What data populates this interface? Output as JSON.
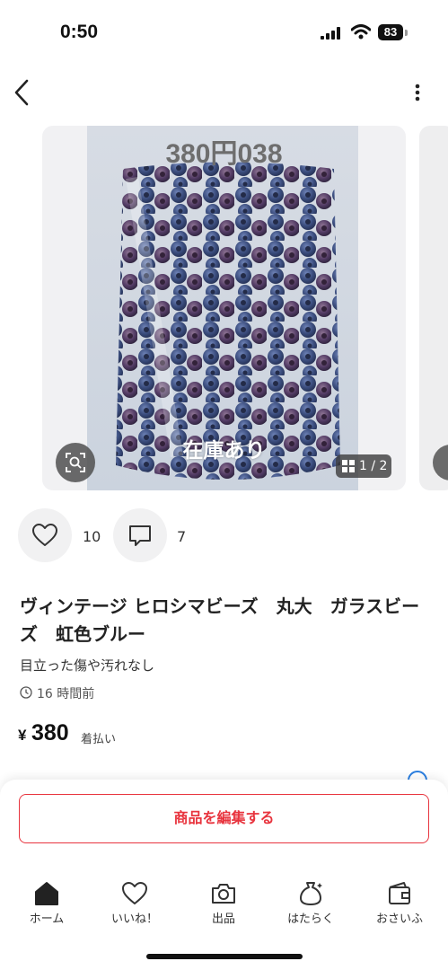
{
  "status_bar": {
    "time": "0:50",
    "battery": "83"
  },
  "nav": {
    "back_icon": "chevron-left-icon",
    "more_icon": "vertical-dots-icon"
  },
  "photo": {
    "top_label": "380円038",
    "bottom_label": "在庫あり",
    "page_indicator": "1 / 2"
  },
  "engagement": {
    "likes": "10",
    "comments": "7"
  },
  "item": {
    "title": "ヴィンテージ ヒロシマビーズ　丸大　ガラスビーズ　虹色ブルー",
    "condition": "目立った傷や汚れなし",
    "posted": "16 時間前",
    "price_symbol": "¥",
    "price": "380",
    "shipping": "着払い"
  },
  "actions": {
    "edit_label": "商品を編集する"
  },
  "tabbar": {
    "items": [
      {
        "label": "ホーム",
        "icon": "home-icon"
      },
      {
        "label": "いいね！",
        "icon": "heart-icon"
      },
      {
        "label": "出品",
        "icon": "camera-icon"
      },
      {
        "label": "はたらく",
        "icon": "money-bag-icon"
      },
      {
        "label": "おさいふ",
        "icon": "wallet-icon"
      }
    ]
  },
  "colors": {
    "accent": "#e8343e",
    "info": "#2a7ee0",
    "bead_blue": "#3a4f86",
    "bead_purple": "#5b3f6b"
  }
}
